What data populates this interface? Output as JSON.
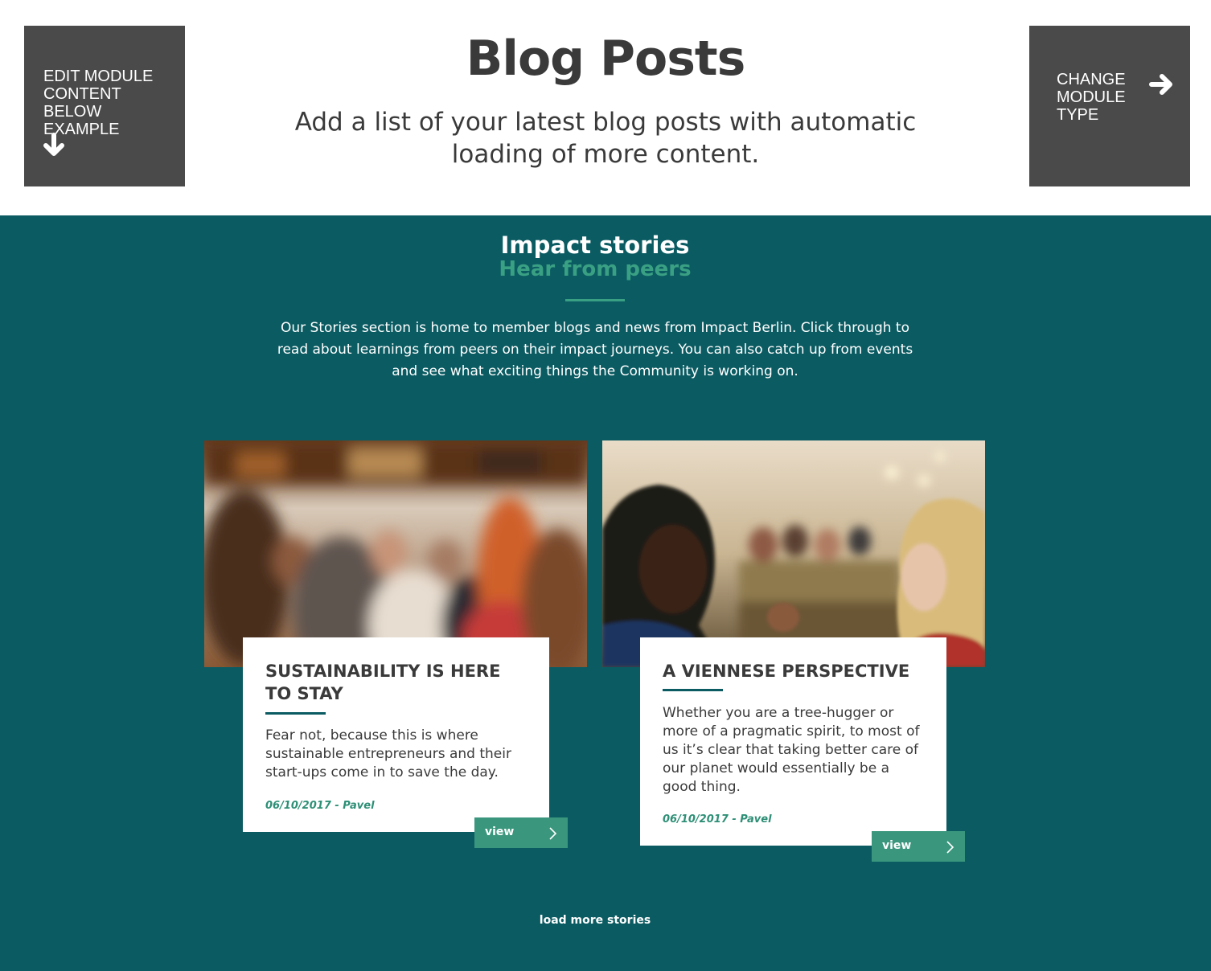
{
  "header": {
    "edit_button": {
      "label": "EDIT MODULE\nCONTENT\nBELOW EXAMPLE",
      "icon": "arrow-down-icon"
    },
    "title": "Blog Posts",
    "subtitle": "Add a list of your latest blog posts with automatic loading of more content.",
    "change_button": {
      "label": "CHANGE\nMODULE\nTYPE",
      "icon": "arrow-right-icon"
    }
  },
  "section": {
    "title": "Impact stories",
    "subtitle": "Hear from peers",
    "intro": "Our Stories section is home to member blogs and news from Impact Berlin. Click through to read about learnings from peers on their impact journeys. You can also catch up from events and see what exciting things the Community is working on.",
    "load_more": "load more stories",
    "colors": {
      "background": "#0b5b62",
      "accent": "#3aa083",
      "button": "#3a977d"
    }
  },
  "posts": [
    {
      "title": "SUSTAINABILITY IS HERE TO STAY",
      "excerpt": "Fear not, because this is where sustainable entrepreneurs and their start-ups come in to save the day.",
      "meta": "06/10/2017 - Pavel",
      "button": "view",
      "icon": "chevron-right-icon"
    },
    {
      "title": "A VIENNESE PERSPECTIVE",
      "excerpt": "Whether you are a tree-hugger or more of a pragmatic spirit, to most of us it’s clear that taking better care of our planet would essentially be a good thing.",
      "meta": "06/10/2017 - Pavel",
      "button": "view",
      "icon": "chevron-right-icon"
    }
  ]
}
